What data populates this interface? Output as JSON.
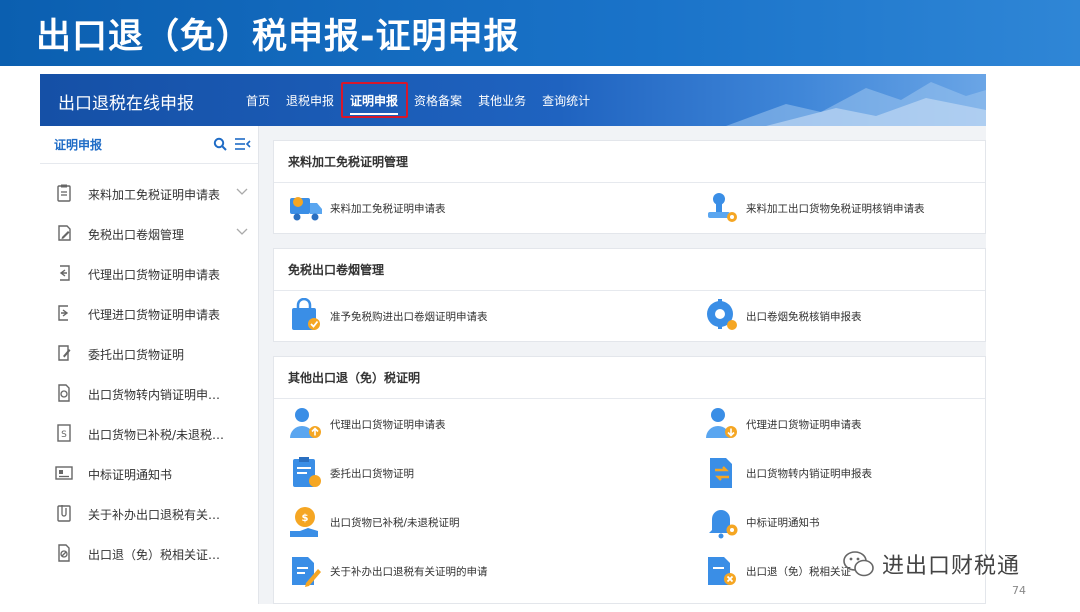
{
  "slide": {
    "title": "出口退（免）税申报-证明申报",
    "page_number": "74"
  },
  "app": {
    "title": "出口退税在线申报",
    "nav": [
      {
        "label": "首页",
        "active": false
      },
      {
        "label": "退税申报",
        "active": false
      },
      {
        "label": "证明申报",
        "active": true
      },
      {
        "label": "资格备案",
        "active": false
      },
      {
        "label": "其他业务",
        "active": false
      },
      {
        "label": "查询统计",
        "active": false
      }
    ]
  },
  "sidebar": {
    "title": "证明申报",
    "items": [
      {
        "label": "来料加工免税证明申请表",
        "icon": "clipboard-icon",
        "expandable": true
      },
      {
        "label": "免税出口卷烟管理",
        "icon": "edit-doc-icon",
        "expandable": true
      },
      {
        "label": "代理出口货物证明申请表",
        "icon": "doc-export-icon",
        "expandable": false
      },
      {
        "label": "代理进口货物证明申请表",
        "icon": "doc-import-icon",
        "expandable": false
      },
      {
        "label": "委托出口货物证明",
        "icon": "pen-doc-icon",
        "expandable": false
      },
      {
        "label": "出口货物转内销证明申…",
        "icon": "doc-cycle-icon",
        "expandable": false
      },
      {
        "label": "出口货物已补税/未退税…",
        "icon": "doc-dollar-icon",
        "expandable": false
      },
      {
        "label": "中标证明通知书",
        "icon": "id-card-icon",
        "expandable": false
      },
      {
        "label": "关于补办出口退税有关…",
        "icon": "clip-doc-icon",
        "expandable": false
      },
      {
        "label": "出口退（免）税相关证…",
        "icon": "doc-slash-icon",
        "expandable": false
      }
    ]
  },
  "sections": [
    {
      "title": "来料加工免税证明管理",
      "entries": [
        {
          "label": "来料加工免税证明申请表",
          "icon": "truck-icon"
        },
        {
          "label": "来料加工出口货物免税证明核销申请表",
          "icon": "stamp-gear-icon"
        }
      ]
    },
    {
      "title": "免税出口卷烟管理",
      "entries": [
        {
          "label": "准予免税购进出口卷烟证明申请表",
          "icon": "shopping-bag-check-icon"
        },
        {
          "label": "出口卷烟免税核销申报表",
          "icon": "gear-user-icon"
        }
      ]
    },
    {
      "title": "其他出口退（免）税证明",
      "entries": [
        {
          "label": "代理出口货物证明申请表",
          "icon": "user-upload-icon"
        },
        {
          "label": "代理进口货物证明申请表",
          "icon": "user-download-icon"
        },
        {
          "label": "委托出口货物证明",
          "icon": "clipboard-user-icon"
        },
        {
          "label": "出口货物转内销证明申报表",
          "icon": "doc-swap-icon"
        },
        {
          "label": "出口货物已补税/未退税证明",
          "icon": "hand-tax-icon"
        },
        {
          "label": "中标证明通知书",
          "icon": "bell-gear-icon"
        },
        {
          "label": "关于补办出口退税有关证明的申请",
          "icon": "doc-pen-icon"
        },
        {
          "label": "出口退（免）税相关证",
          "icon": "doc-close-icon"
        }
      ]
    }
  ],
  "watermark": {
    "text": "进出口财税通"
  },
  "colors": {
    "header": "#1f63c0",
    "accent": "#1f6cc6",
    "icon_blue": "#3a8ee6",
    "icon_orange": "#f5a623",
    "highlight": "#d6182b"
  }
}
